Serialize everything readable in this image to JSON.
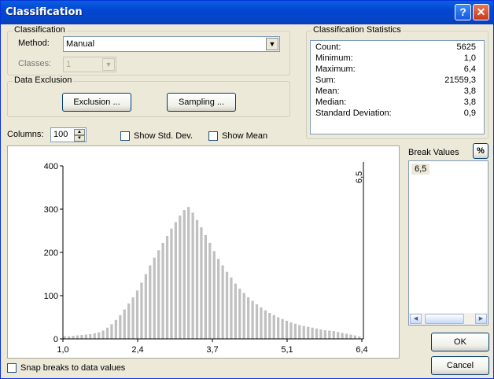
{
  "window": {
    "title": "Classification",
    "help_label": "?",
    "close_label": "✕"
  },
  "classification": {
    "group_label": "Classification",
    "method_label": "Method:",
    "method_value": "Manual",
    "classes_label": "Classes:",
    "classes_value": "1"
  },
  "data_exclusion": {
    "group_label": "Data Exclusion",
    "exclusion_button": "Exclusion ...",
    "sampling_button": "Sampling ..."
  },
  "statistics": {
    "group_label": "Classification Statistics",
    "rows": [
      {
        "key": "Count:",
        "value": "5625"
      },
      {
        "key": "Minimum:",
        "value": "1,0"
      },
      {
        "key": "Maximum:",
        "value": "6,4"
      },
      {
        "key": "Sum:",
        "value": "21559,3"
      },
      {
        "key": "Mean:",
        "value": "3,8"
      },
      {
        "key": "Median:",
        "value": "3,8"
      },
      {
        "key": "Standard Deviation:",
        "value": "0,9"
      }
    ]
  },
  "controls": {
    "columns_label": "Columns:",
    "columns_value": "100",
    "show_std_dev": "Show Std. Dev.",
    "show_mean": "Show Mean",
    "snap_breaks": "Snap breaks to data values"
  },
  "break_values": {
    "label": "Break Values",
    "percent_button": "%",
    "items": [
      "6,5"
    ]
  },
  "buttons": {
    "ok": "OK",
    "cancel": "Cancel"
  },
  "chart_data": {
    "type": "bar",
    "xlim": [
      1.0,
      6.4
    ],
    "ylim": [
      0,
      400
    ],
    "x_ticks": [
      "1,0",
      "2,4",
      "3,7",
      "5,1",
      "6,4"
    ],
    "y_ticks": [
      "0",
      "100",
      "200",
      "300",
      "400"
    ],
    "break_line_label": "6,5",
    "values": [
      6,
      6,
      7,
      8,
      9,
      10,
      11,
      13,
      15,
      19,
      26,
      34,
      44,
      55,
      68,
      82,
      96,
      112,
      130,
      150,
      170,
      188,
      205,
      222,
      238,
      255,
      270,
      285,
      298,
      305,
      292,
      275,
      258,
      240,
      222,
      203,
      185,
      170,
      155,
      142,
      128,
      116,
      106,
      96,
      88,
      80,
      73,
      66,
      60,
      55,
      50,
      46,
      42,
      38,
      35,
      32,
      30,
      28,
      26,
      24,
      22,
      20,
      19,
      18,
      16,
      14,
      12,
      10,
      8,
      6
    ]
  }
}
